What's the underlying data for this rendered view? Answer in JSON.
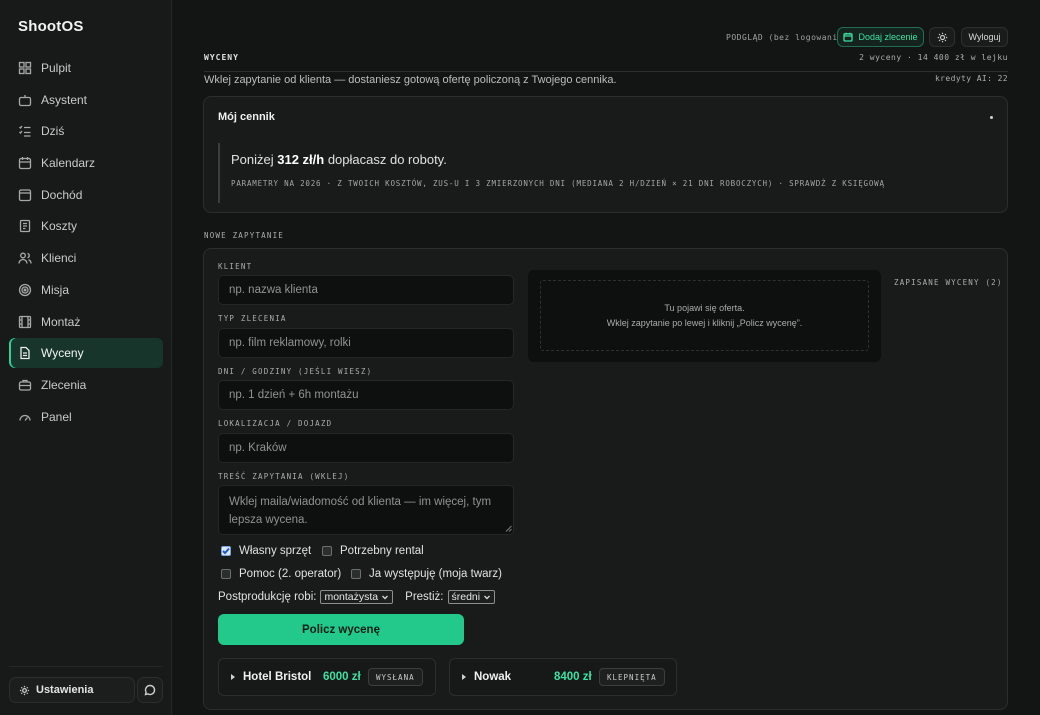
{
  "app": {
    "name": "ShootOS"
  },
  "sidebar": {
    "items": [
      {
        "label": "Pulpit",
        "icon": "grid-icon"
      },
      {
        "label": "Asystent",
        "icon": "bot-icon"
      },
      {
        "label": "Dziś",
        "icon": "checklist-icon"
      },
      {
        "label": "Kalendarz",
        "icon": "calendar-icon"
      },
      {
        "label": "Dochód",
        "icon": "wallet-icon"
      },
      {
        "label": "Koszty",
        "icon": "receipt-icon"
      },
      {
        "label": "Klienci",
        "icon": "users-icon"
      },
      {
        "label": "Misja",
        "icon": "target-icon"
      },
      {
        "label": "Montaż",
        "icon": "film-icon"
      },
      {
        "label": "Wyceny",
        "icon": "document-icon",
        "active": true
      },
      {
        "label": "Zlecenia",
        "icon": "briefcase-icon"
      },
      {
        "label": "Panel",
        "icon": "gauge-icon"
      }
    ],
    "settings_label": "Ustawienia"
  },
  "topbar": {
    "preview": "PODGLĄD (bez logowania)",
    "add_order": "Dodaj zlecenie",
    "logout": "Wyloguj"
  },
  "page": {
    "title": "WYCENY",
    "pipeline": "2 wyceny · 14 400 zł w lejku",
    "credits": "kredyty AI: 22",
    "intro": "Wklej zapytanie od klienta — dostaniesz gotową ofertę policzoną z Twojego cennika."
  },
  "cennik": {
    "title": "Mój cennik",
    "main_prefix": "Poniżej ",
    "main_rate": "312 zł/h",
    "main_suffix": " dopłacasz do roboty.",
    "params": "PARAMETRY NA 2026 · Z TWOICH KOSZTÓW, ZUS-U I 3 ZMIERZONYCH DNI (MEDIANA 2 H/DZIEŃ × 21 DNI ROBOCZYCH) · SPRAWDŹ Z KSIĘGOWĄ"
  },
  "new_request": {
    "section_label": "NOWE ZAPYTANIE",
    "client_label": "KLIENT",
    "client_placeholder": "np. nazwa klienta",
    "type_label": "TYP ZLECENIA",
    "type_placeholder": "np. film reklamowy, rolki",
    "days_label": "DNI / GODZINY (JEŚLI WIESZ)",
    "days_placeholder": "np. 1 dzień + 6h montażu",
    "location_label": "LOKALIZACJA / DOJAZD",
    "location_placeholder": "np. Kraków",
    "content_label": "TREŚĆ ZAPYTANIA (WKLEJ)",
    "content_placeholder": "Wklej maila/wiadomość od klienta — im więcej, tym lepsza wycena.",
    "checkboxes": [
      {
        "label": "Własny sprzęt",
        "checked": true
      },
      {
        "label": "Potrzebny rental",
        "checked": false
      },
      {
        "label": "Pomoc (2. operator)",
        "checked": false
      },
      {
        "label": "Ja występuję (moja twarz)",
        "checked": false
      }
    ],
    "postprod_label": "Postprodukcję robi:",
    "postprod_value": "montażysta",
    "prestige_label": "Prestiż:",
    "prestige_value": "średni",
    "calc_button": "Policz wycenę"
  },
  "result": {
    "line1": "Tu pojawi się oferta.",
    "line2": "Wklej zapytanie po lewej i kliknij „Policz wycenę”."
  },
  "saved": {
    "label": "ZAPISANE WYCENY (2)",
    "quotes": [
      {
        "name": "Hotel Bristol",
        "amount": "6000 zł",
        "status": "WYSŁANA"
      },
      {
        "name": "Nowak",
        "amount": "8400 zł",
        "status": "KLEPNIĘTA"
      }
    ]
  }
}
